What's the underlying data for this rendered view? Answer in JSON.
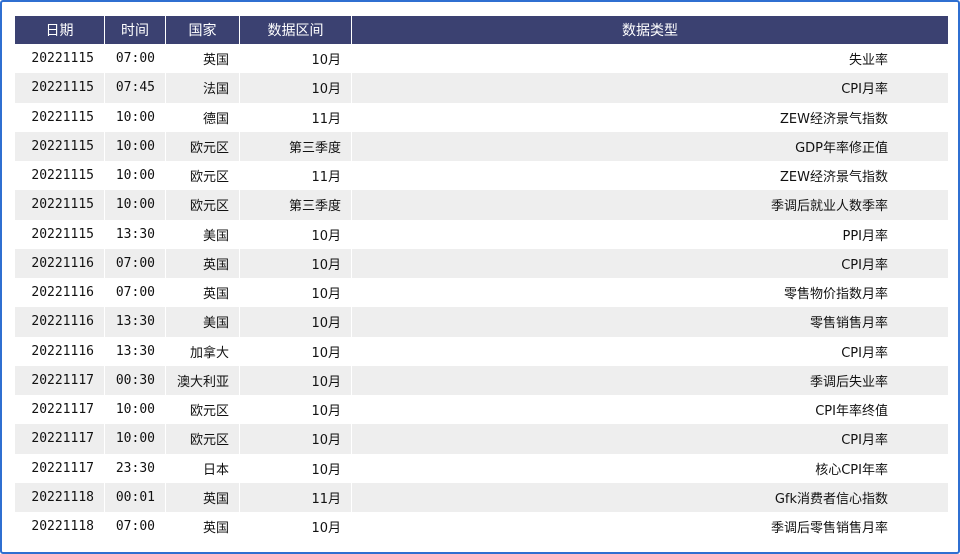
{
  "table": {
    "headers": [
      "日期",
      "时间",
      "国家",
      "数据区间",
      "数据类型"
    ],
    "rows": [
      [
        "20221115",
        "07:00",
        "英国",
        "10月",
        "失业率"
      ],
      [
        "20221115",
        "07:45",
        "法国",
        "10月",
        "CPI月率"
      ],
      [
        "20221115",
        "10:00",
        "德国",
        "11月",
        "ZEW经济景气指数"
      ],
      [
        "20221115",
        "10:00",
        "欧元区",
        "第三季度",
        "GDP年率修正值"
      ],
      [
        "20221115",
        "10:00",
        "欧元区",
        "11月",
        "ZEW经济景气指数"
      ],
      [
        "20221115",
        "10:00",
        "欧元区",
        "第三季度",
        "季调后就业人数季率"
      ],
      [
        "20221115",
        "13:30",
        "美国",
        "10月",
        "PPI月率"
      ],
      [
        "20221116",
        "07:00",
        "英国",
        "10月",
        "CPI月率"
      ],
      [
        "20221116",
        "07:00",
        "英国",
        "10月",
        "零售物价指数月率"
      ],
      [
        "20221116",
        "13:30",
        "美国",
        "10月",
        "零售销售月率"
      ],
      [
        "20221116",
        "13:30",
        "加拿大",
        "10月",
        "CPI月率"
      ],
      [
        "20221117",
        "00:30",
        "澳大利亚",
        "10月",
        "季调后失业率"
      ],
      [
        "20221117",
        "10:00",
        "欧元区",
        "10月",
        "CPI年率终值"
      ],
      [
        "20221117",
        "10:00",
        "欧元区",
        "10月",
        "CPI月率"
      ],
      [
        "20221117",
        "23:30",
        "日本",
        "10月",
        "核心CPI年率"
      ],
      [
        "20221118",
        "00:01",
        "英国",
        "11月",
        "Gfk消费者信心指数"
      ],
      [
        "20221118",
        "07:00",
        "英国",
        "10月",
        "季调后零售销售月率"
      ]
    ]
  },
  "colors": {
    "header_bg": "#3b4171",
    "header_text": "#ffffff",
    "stripe_bg": "#eeeeee",
    "frame_border": "#2f6fd1"
  }
}
